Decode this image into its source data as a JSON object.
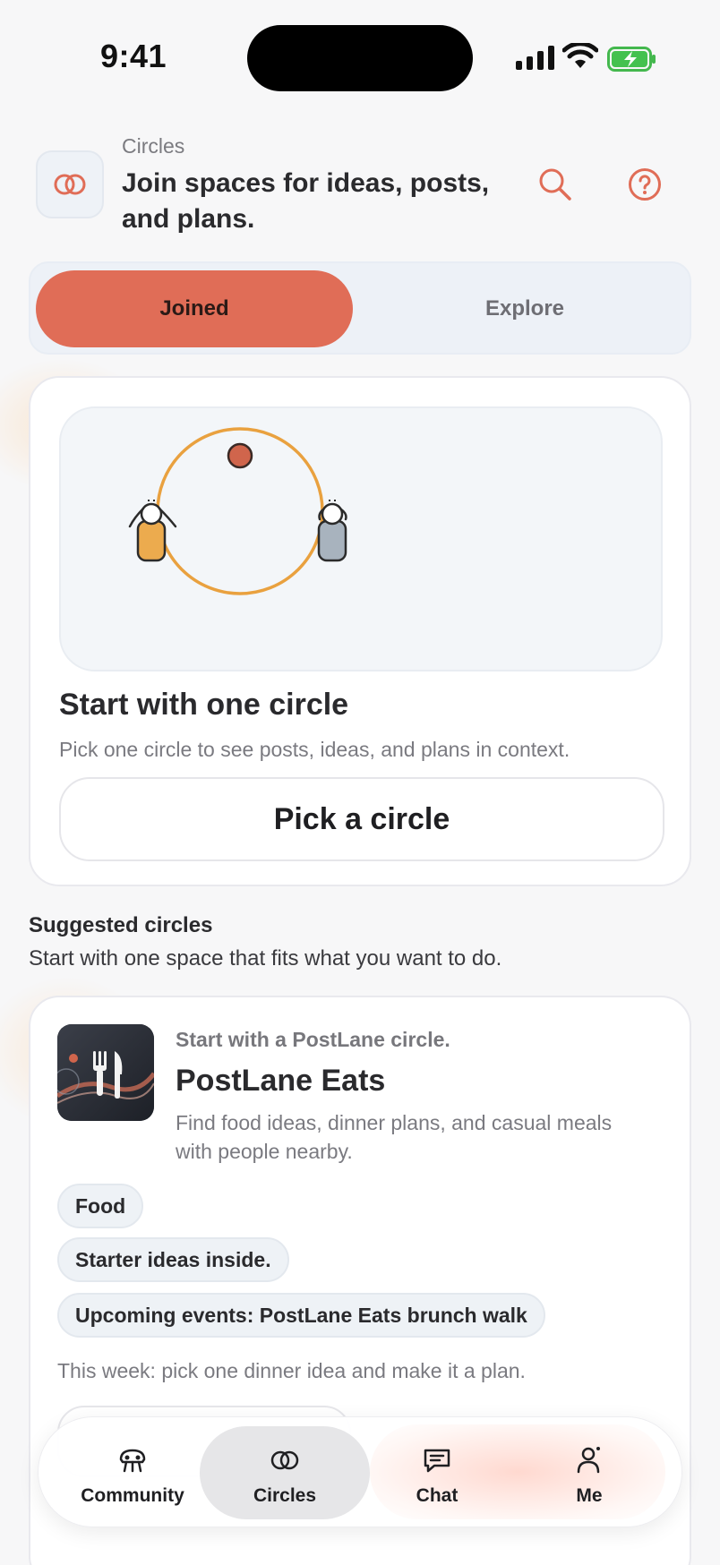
{
  "status_bar": {
    "time": "9:41"
  },
  "header": {
    "eyebrow": "Circles",
    "title": "Join spaces for ideas, posts, and plans."
  },
  "segmented": {
    "joined": "Joined",
    "explore": "Explore",
    "selected": "Joined"
  },
  "empty_state": {
    "title": "Start with one circle",
    "description": "Pick one circle to see posts, ideas, and plans in context.",
    "button": "Pick a circle"
  },
  "suggested": {
    "title": "Suggested circles",
    "subtitle": "Start with one space that fits what you want to do.",
    "card": {
      "eyebrow": "Start with a PostLane circle.",
      "name": "PostLane Eats",
      "description": "Find food ideas, dinner plans, and casual meals with people nearby.",
      "chips": [
        "Food",
        "Starter ideas inside.",
        "Upcoming events: PostLane Eats brunch walk"
      ],
      "week_note": "This week: pick one dinner idea and make it a plan."
    }
  },
  "tabbar": {
    "tabs": [
      {
        "label": "Community",
        "icon": "community-icon"
      },
      {
        "label": "Circles",
        "icon": "circles-icon",
        "active": true
      },
      {
        "label": "Chat",
        "icon": "chat-icon"
      },
      {
        "label": "Me",
        "icon": "person-icon"
      }
    ]
  },
  "colors": {
    "accent": "#e06d57",
    "ring": "#e9a13f",
    "background": "#f7f7f8"
  }
}
